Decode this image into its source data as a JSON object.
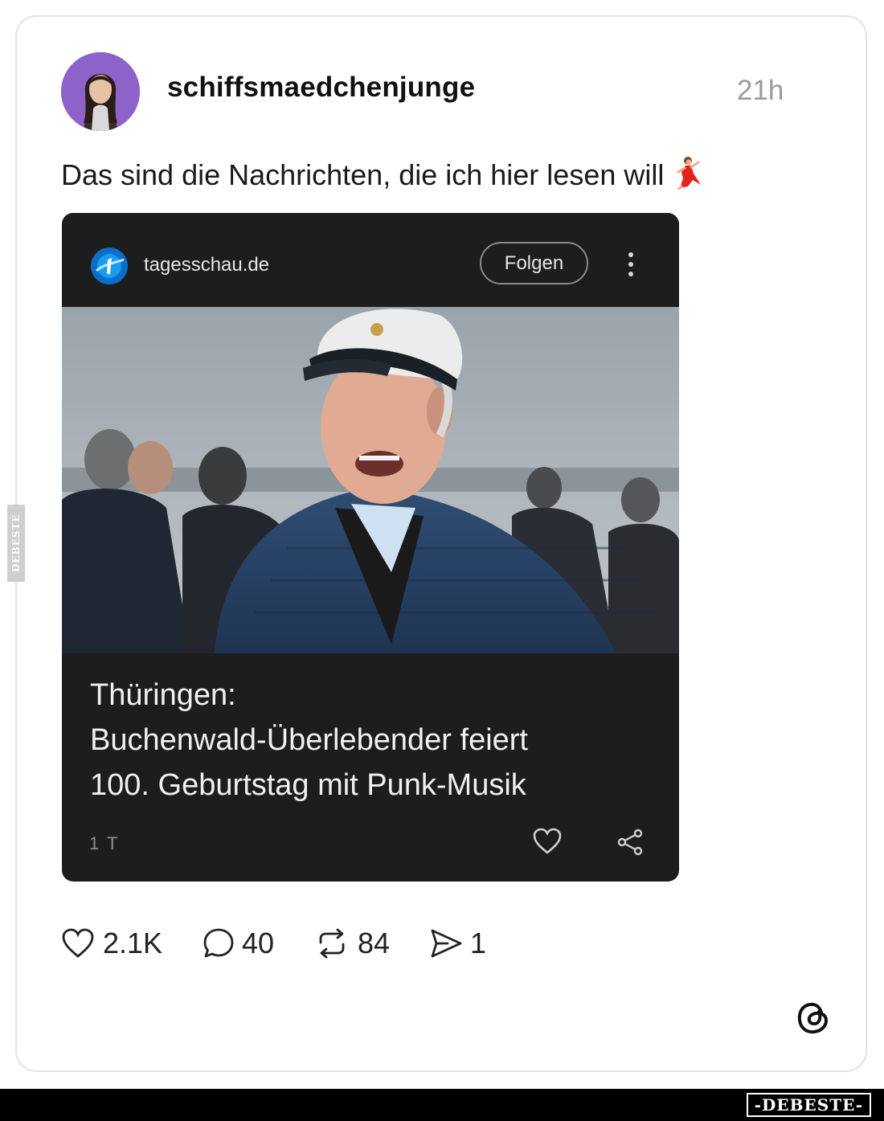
{
  "post": {
    "username": "schiffsmaedchenjunge",
    "time": "21h",
    "text": "Das sind die Nachrichten, die ich hier lesen will"
  },
  "embed": {
    "source": "tagesschau.de",
    "follow_label": "Folgen",
    "headline_line1": "Thüringen:",
    "headline_line2": "Buchenwald-Überlebender feiert",
    "headline_line3": "100. Geburtstag mit Punk-Musik",
    "age": "1 T"
  },
  "actions": {
    "likes": "2.1K",
    "comments": "40",
    "reposts": "84",
    "shares": "1"
  },
  "watermark": {
    "footer": "-DEBESTE-",
    "side": "DEBESTE"
  },
  "colors": {
    "embed_bg": "#1d1d1d",
    "avatar_bg": "#8e63c9",
    "muted_text": "#9a9a9a"
  },
  "icons": [
    "heart-icon",
    "comment-icon",
    "repost-icon",
    "send-icon",
    "share-icon",
    "more-icon",
    "threads-logo-icon"
  ]
}
